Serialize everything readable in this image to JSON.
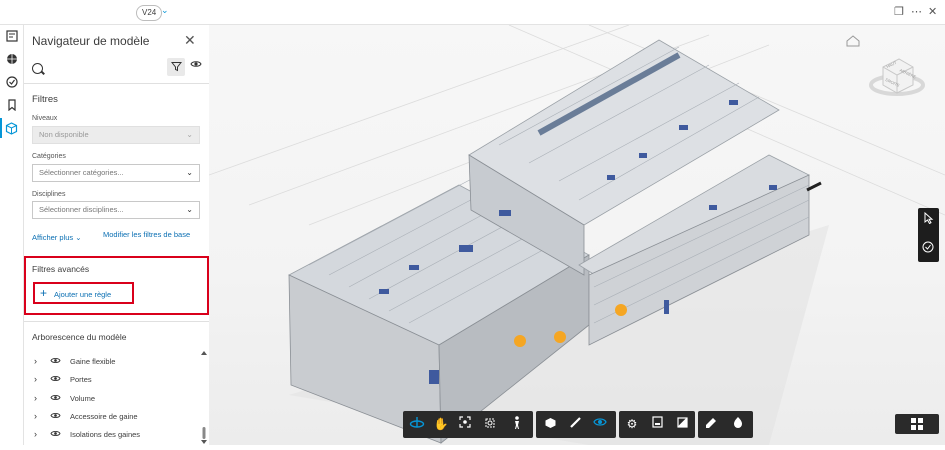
{
  "topbar": {
    "version": "V24",
    "version_chevron_icon": "chevron-down-icon",
    "right_icons": [
      "overlay-windows-icon",
      "more-icon",
      "close-icon"
    ]
  },
  "rail": {
    "icons": [
      "sheets-icon",
      "3d-sphere-icon",
      "issues-icon",
      "bookmark-icon",
      "model-browser-icon"
    ],
    "active": "model-browser-icon",
    "accent": "#0696d7"
  },
  "panel": {
    "title": "Navigateur de modèle",
    "search": {
      "placeholder": "",
      "value": ""
    },
    "filters": {
      "title": "Filtres",
      "levels": {
        "label": "Niveaux",
        "value": "Non disponible"
      },
      "categories": {
        "label": "Catégories",
        "placeholder": "Sélectionner catégories..."
      },
      "disciplines": {
        "label": "Disciplines",
        "placeholder": "Sélectionner disciplines..."
      },
      "show_more": "Afficher plus",
      "modify_base": "Modifier les filtres de base"
    },
    "advanced": {
      "title": "Filtres avancés",
      "add_rule": "Ajouter une règle",
      "highlight_color": "#d9001b"
    },
    "tree": {
      "title": "Arborescence du modèle",
      "items": [
        {
          "label": "Gaine flexible"
        },
        {
          "label": "Portes"
        },
        {
          "label": "Volume"
        },
        {
          "label": "Accessoire de gaine"
        },
        {
          "label": "Isolations des gaines"
        }
      ]
    }
  },
  "viewport": {
    "toolbar_groups": [
      [
        "orbit-icon",
        "pan-icon",
        "fit-view-icon",
        "zoom-window-icon",
        "first-person-icon"
      ],
      [
        "section-box-icon",
        "measure-icon",
        "explode-icon"
      ],
      [
        "settings-icon",
        "properties-icon",
        "model-browser-icon"
      ],
      [
        "markup-icon",
        "issue-pin-icon"
      ]
    ],
    "side_tools": [
      "select-cursor-icon",
      "check-circle-icon"
    ],
    "viewcube_labels": [
      "HAUT",
      "ARRIÈRE",
      "DROITE"
    ],
    "accent": "#0696d7",
    "marker_color": "#f5a623"
  }
}
